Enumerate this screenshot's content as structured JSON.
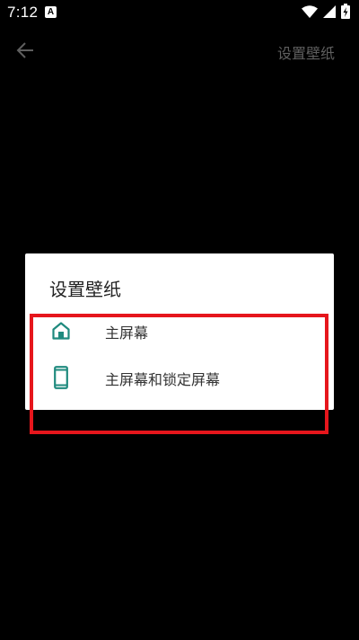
{
  "status_bar": {
    "time": "7:12",
    "notification_icon": "A",
    "icons": [
      "wifi-icon",
      "signal-icon",
      "battery-charging-icon"
    ]
  },
  "app_bar": {
    "back_icon": "arrow-back-icon",
    "action_label": "设置壁纸"
  },
  "dialog": {
    "title": "设置壁纸",
    "options": [
      {
        "icon": "home-icon",
        "label": "主屏幕"
      },
      {
        "icon": "phone-icon",
        "label": "主屏幕和锁定屏幕"
      }
    ]
  },
  "colors": {
    "background": "#000000",
    "dialog_background": "#ffffff",
    "icon_accent": "#1f8a7e",
    "highlight": "#e6161c"
  }
}
